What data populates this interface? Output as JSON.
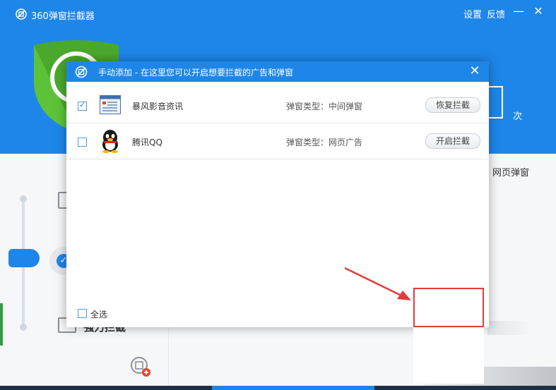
{
  "app": {
    "title": "360弹窗拦截器",
    "settings_label": "设置",
    "feedback_label": "反馈",
    "minimize_glyph": "—",
    "close_glyph": "✕",
    "times_label": "次",
    "web_popup_label": "网页弹窗",
    "force_block_label": "強力拦截"
  },
  "dialog": {
    "title": "手动添加 - 在这里您可以开启想要拦截的广告和弹窗",
    "close_glyph": "✕",
    "rows": [
      {
        "checked": true,
        "name": "暴风影音资讯",
        "type": "弹窗类型：中间弹窗",
        "button": "恢复拦截",
        "icon": "baofeng-news-icon"
      },
      {
        "checked": false,
        "name": "腾讯QQ",
        "type": "弹窗类型：网页广告",
        "button": "开启拦截",
        "icon": "qq-penguin-icon"
      }
    ],
    "select_all_label": "全选"
  },
  "colors": {
    "brand_blue": "#1e86e8",
    "shield_green": "#5cc338",
    "annotation_red": "#e23a3a"
  }
}
